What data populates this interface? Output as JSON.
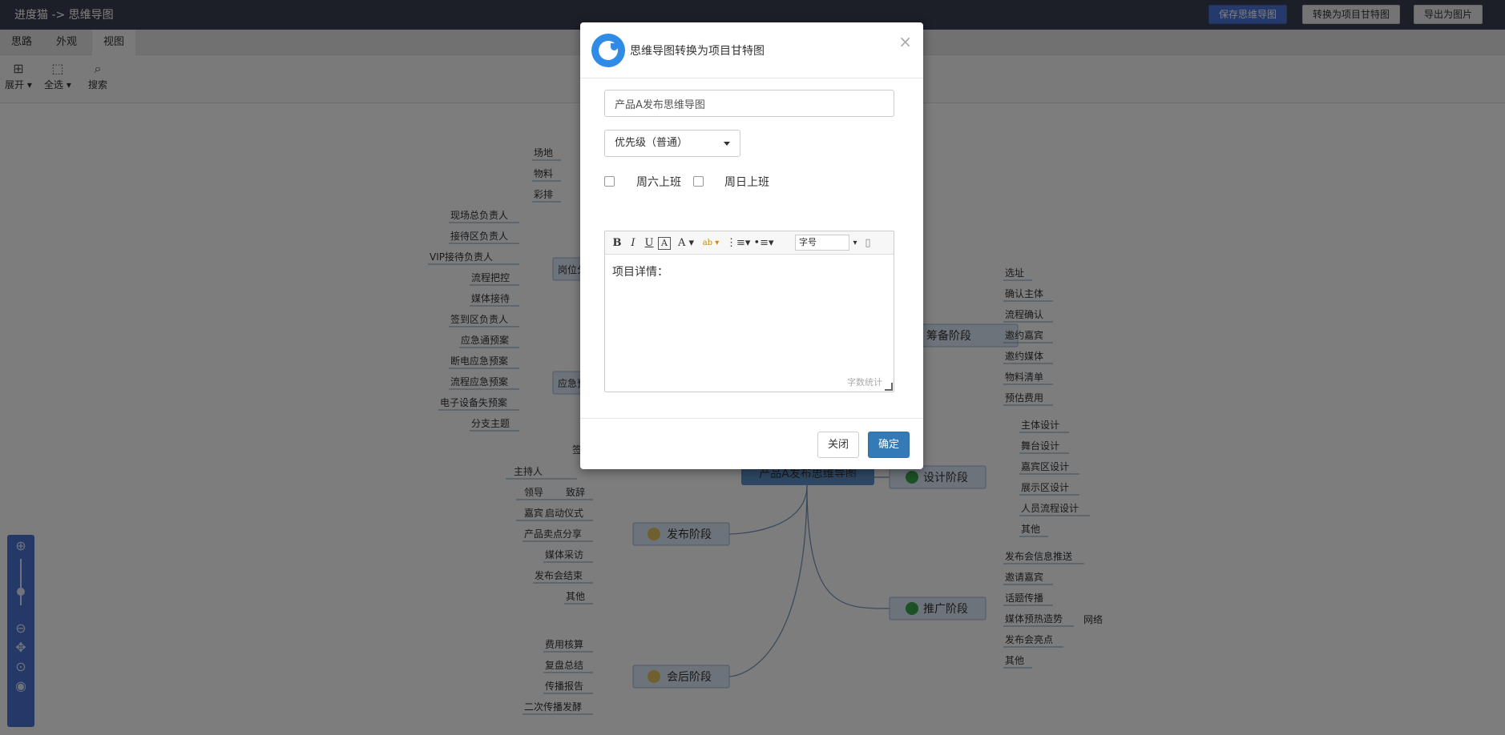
{
  "app": {
    "title": "进度猫 -> 思维导图",
    "buttons": {
      "save": "保存思维导图",
      "convert": "转换为项目甘特图",
      "export": "导出为图片"
    }
  },
  "tabs": [
    "思路",
    "外观",
    "视图"
  ],
  "toolbar": {
    "expand": "展开",
    "select_all": "全选",
    "search": "搜索"
  },
  "mindmap": {
    "root": "产品A发布思维导图",
    "branches": [
      {
        "label": "筹备阶段",
        "children": [
          "选址",
          "确认主体",
          "流程确认",
          "邀约嘉宾",
          "邀约媒体",
          "物料清单",
          "预估费用"
        ]
      },
      {
        "label": "设计阶段",
        "children": [
          "主体设计",
          "舞台设计",
          "嘉宾区设计",
          "展示区设计",
          "人员流程设计",
          "其他"
        ]
      },
      {
        "label": "推广阶段",
        "children": [
          "发布会信息推送",
          "邀请嘉宾",
          "话题传播",
          "媒体预热造势",
          "发布会亮点",
          "其他"
        ],
        "extra": "网络"
      },
      {
        "label": "发布阶段",
        "children": [
          "致辞",
          "启动仪式",
          "产品卖点分享",
          "媒体采访",
          "发布会结束",
          "其他"
        ],
        "sub": [
          "主持人",
          "领导",
          "嘉宾"
        ],
        "sub_head": "签"
      },
      {
        "label": "会后阶段",
        "children": [
          "费用核算",
          "复盘总结",
          "传播报告",
          "二次传播发酵"
        ]
      },
      {
        "label": "岗位分",
        "children": [
          "现场总负责人",
          "接待区负责人",
          "VIP接待负责人",
          "流程把控",
          "媒体接待",
          "签到区负责人"
        ]
      },
      {
        "label": "应急预",
        "children": [
          "应急通预案",
          "断电应急预案",
          "流程应急预案",
          "电子设备失预案",
          "分支主题"
        ]
      },
      {
        "label": "",
        "children": [
          "场地",
          "物料",
          "彩排"
        ]
      }
    ]
  },
  "modal": {
    "title": "思维导图转换为项目甘特图",
    "project_name": "产品A发布思维导图",
    "priority": "优先级（普通）",
    "saturday": "周六上班",
    "sunday": "周日上班",
    "editor": {
      "font_size": "字号",
      "content": "项目详情：",
      "count": "字数统计"
    },
    "close": "关闭",
    "confirm": "确定"
  },
  "colors": {
    "topbar": "#393f4f",
    "accent": "#4a72d4",
    "primary_button": "#337ab7",
    "node_fill": "#dbe7f4",
    "root_fill": "#5b8fc9"
  }
}
